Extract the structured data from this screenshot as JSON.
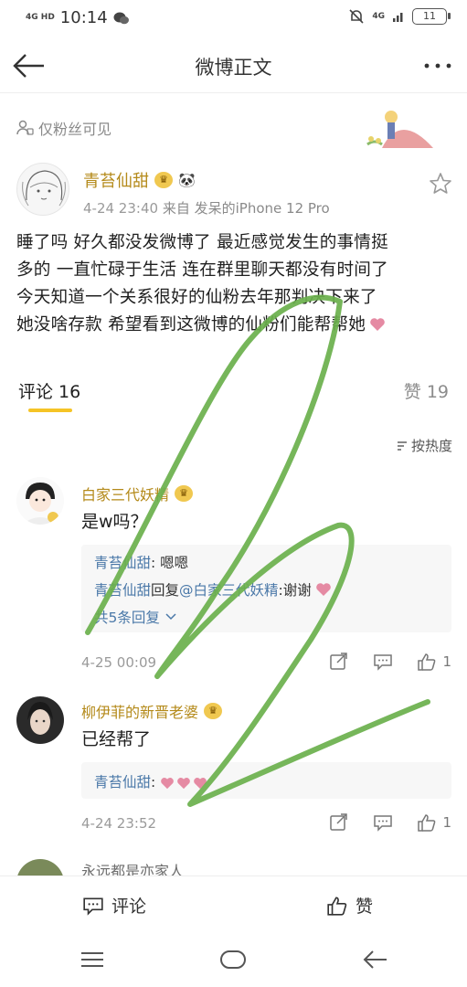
{
  "status_bar": {
    "network": "4G HD",
    "time": "10:14",
    "network_right": "4G",
    "battery": "11"
  },
  "header": {
    "title": "微博正文",
    "back_icon": "arrow-left-icon",
    "more_icon": "more-dots-icon"
  },
  "post": {
    "visibility": "仅粉丝可见",
    "author": "青苔仙甜",
    "time": "4-24 23:40",
    "source_prefix": "来自",
    "source": "发呆的iPhone 12 Pro",
    "text_lines": [
      "睡了吗 好久都没发微博了 最近感觉发生的事情挺",
      "多的 一直忙碌于生活 连在群里聊天都没有时间了",
      "今天知道一个关系很好的仙粉去年那判决下来了",
      "她没啥存款 希望看到这微博的仙粉们能帮帮她"
    ]
  },
  "tabs": {
    "comments": "评论 16",
    "likes": "赞 19",
    "sort": "按热度"
  },
  "comments": [
    {
      "author": "白家三代妖精",
      "text": "是w吗？",
      "replies": [
        {
          "name": "青苔仙甜",
          "sep": ": ",
          "text": "嗯嗯"
        },
        {
          "name": "青苔仙甜",
          "sep": "回复",
          "target": "@白家三代妖精",
          "text": ":谢谢"
        }
      ],
      "more_replies": "共5条回复",
      "time": "4-25 00:09",
      "likes": "1"
    },
    {
      "author": "柳伊菲的新晋老婆",
      "text": "已经帮了",
      "replies": [
        {
          "name": "青苔仙甜",
          "sep": ": ",
          "text": ""
        }
      ],
      "time": "4-24 23:52",
      "likes": "1"
    },
    {
      "author": "永远都是亦家人"
    }
  ],
  "bottom_bar": {
    "comment": "评论",
    "like": "赞"
  },
  "colors": {
    "accent": "#f5c426",
    "username": "#b48a1a",
    "link": "#4a78a8",
    "scribble": "#6ab04c"
  }
}
